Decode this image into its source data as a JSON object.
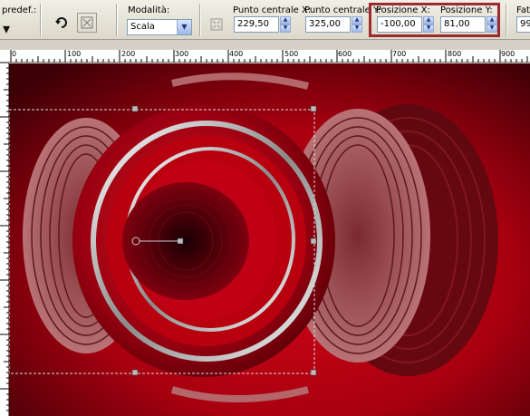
{
  "toolbar": {
    "preset_label": "predef.:",
    "mode_label": "Modalità:",
    "mode_value": "Scala",
    "center_x_label": "Punto centrale X:",
    "center_x_value": "229,50",
    "center_y_label": "Punto centrale Y:",
    "center_y_value": "325,00",
    "pos_x_label": "Posizione X:",
    "pos_x_value": "-100,00",
    "pos_y_label": "Posizione Y:",
    "pos_y_value": "81,00",
    "truncated_label": "Fat",
    "truncated_value": "99",
    "highlight_color": "#9d2a2e"
  },
  "ruler": {
    "ticks": [
      "0",
      "100",
      "200",
      "300",
      "400",
      "500",
      "600",
      "700",
      "800",
      "900"
    ]
  },
  "colors": {
    "canvas_base": "#b00010",
    "canvas_dark": "#3a0006"
  }
}
